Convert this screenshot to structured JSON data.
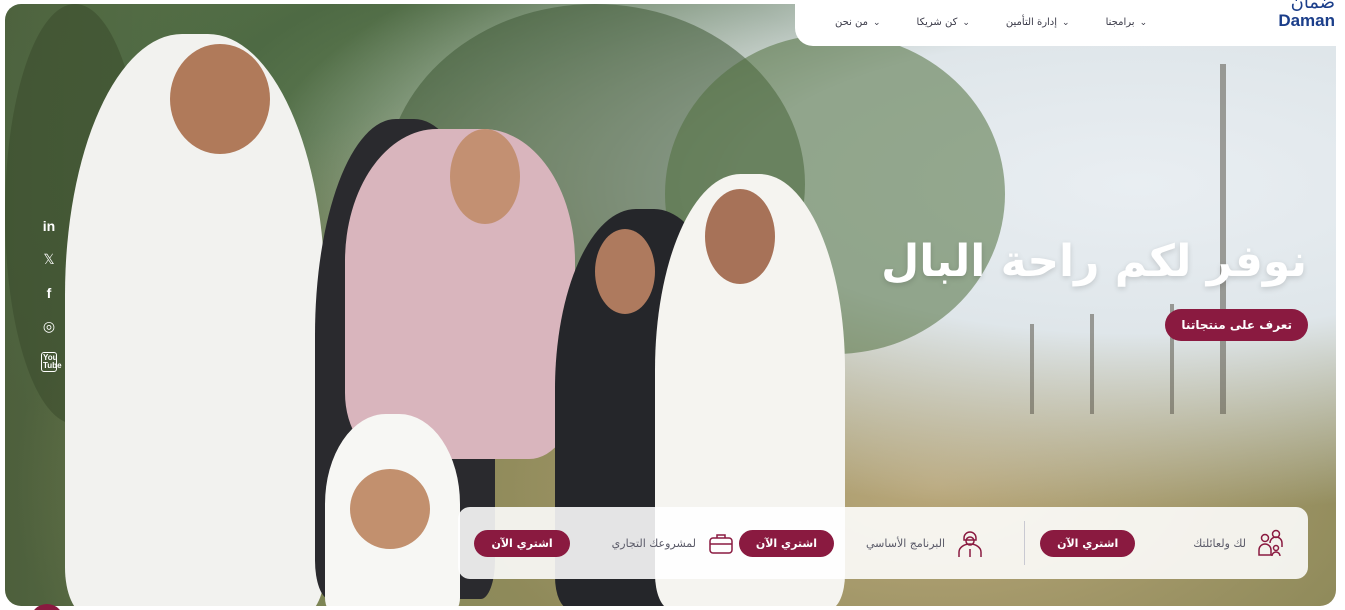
{
  "brand": {
    "logo_ar": "ضمان",
    "logo_en": "Daman"
  },
  "nav": {
    "items": [
      {
        "label": "برامجنا"
      },
      {
        "label": "إدارة التأمين"
      },
      {
        "label": "كن شريكا"
      },
      {
        "label": "من نحن"
      }
    ],
    "chevron": "⌄"
  },
  "social": {
    "linkedin": "in",
    "x": "𝕏",
    "facebook": "f",
    "instagram": "◎",
    "youtube": "You Tube"
  },
  "hero": {
    "title": "نوفر لكم راحة البال",
    "cta": "تعرف على منتجاتنا"
  },
  "products": [
    {
      "label": "لك ولعائلتك",
      "button": "اشتري الآن",
      "icon": "family-icon"
    },
    {
      "label": "البرنامج الأساسي",
      "button": "اشتري الآن",
      "icon": "worker-icon"
    },
    {
      "label": "لمشروعك التجاري",
      "button": "اشتري الآن",
      "icon": "briefcase-icon"
    }
  ],
  "colors": {
    "accent": "#8a1a40",
    "brand": "#1b3e8a"
  }
}
